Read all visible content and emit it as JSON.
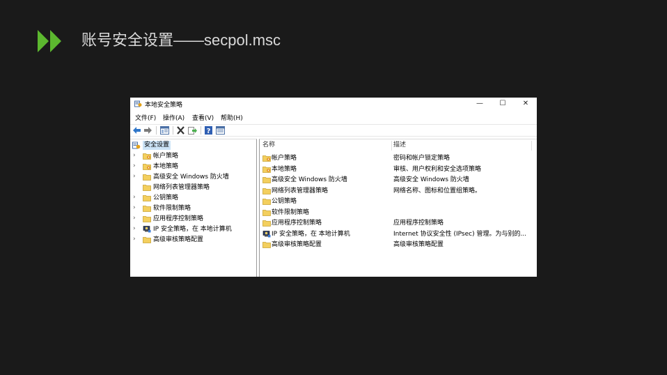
{
  "slide": {
    "title": "账号安全设置——secpol.msc"
  },
  "window": {
    "title": "本地安全策略",
    "controls": {
      "minimize": "—",
      "maximize": "☐",
      "close": "✕"
    }
  },
  "menu": [
    "文件(F)",
    "操作(A)",
    "查看(V)",
    "帮助(H)"
  ],
  "toolbar": [
    "back-icon",
    "forward-icon",
    "console-tree-icon",
    "delete-icon",
    "export-icon",
    "help-icon",
    "properties-icon"
  ],
  "tree": {
    "root": "安全设置",
    "items": [
      {
        "label": "帐户策略",
        "icon": "policy-folder-icon",
        "expandable": true
      },
      {
        "label": "本地策略",
        "icon": "policy-folder-icon",
        "expandable": true
      },
      {
        "label": "高级安全 Windows 防火墙",
        "icon": "folder-icon",
        "expandable": true
      },
      {
        "label": "网络列表管理器策略",
        "icon": "folder-icon",
        "expandable": false
      },
      {
        "label": "公钥策略",
        "icon": "folder-icon",
        "expandable": true
      },
      {
        "label": "软件限制策略",
        "icon": "folder-icon",
        "expandable": true
      },
      {
        "label": "应用程序控制策略",
        "icon": "folder-icon",
        "expandable": true
      },
      {
        "label": "IP 安全策略，在 本地计算机",
        "icon": "ipsec-icon",
        "expandable": true
      },
      {
        "label": "高级审核策略配置",
        "icon": "folder-icon",
        "expandable": true
      }
    ]
  },
  "list": {
    "columns": [
      "名称",
      "描述"
    ],
    "rows": [
      {
        "name": "帐户策略",
        "desc": "密码和帐户锁定策略",
        "icon": "policy-folder-icon"
      },
      {
        "name": "本地策略",
        "desc": "审核、用户权利和安全选项策略",
        "icon": "policy-folder-icon"
      },
      {
        "name": "高级安全 Windows 防火墙",
        "desc": "高级安全 Windows 防火墙",
        "icon": "folder-icon"
      },
      {
        "name": "网络列表管理器策略",
        "desc": "网络名称、图标和位置组策略。",
        "icon": "folder-icon"
      },
      {
        "name": "公钥策略",
        "desc": "",
        "icon": "folder-icon"
      },
      {
        "name": "软件限制策略",
        "desc": "",
        "icon": "folder-icon"
      },
      {
        "name": "应用程序控制策略",
        "desc": "应用程序控制策略",
        "icon": "folder-icon"
      },
      {
        "name": "IP 安全策略，在 本地计算机",
        "desc": "Internet 协议安全性 (IPsec) 管理。为与别的...",
        "icon": "ipsec-icon"
      },
      {
        "name": "高级审核策略配置",
        "desc": "高级审核策略配置",
        "icon": "folder-icon"
      }
    ]
  },
  "colors": {
    "accent": "#5cb82f",
    "background": "#1a1a1a",
    "selection": "#cce4f7",
    "folder": "#f3cf5e"
  }
}
